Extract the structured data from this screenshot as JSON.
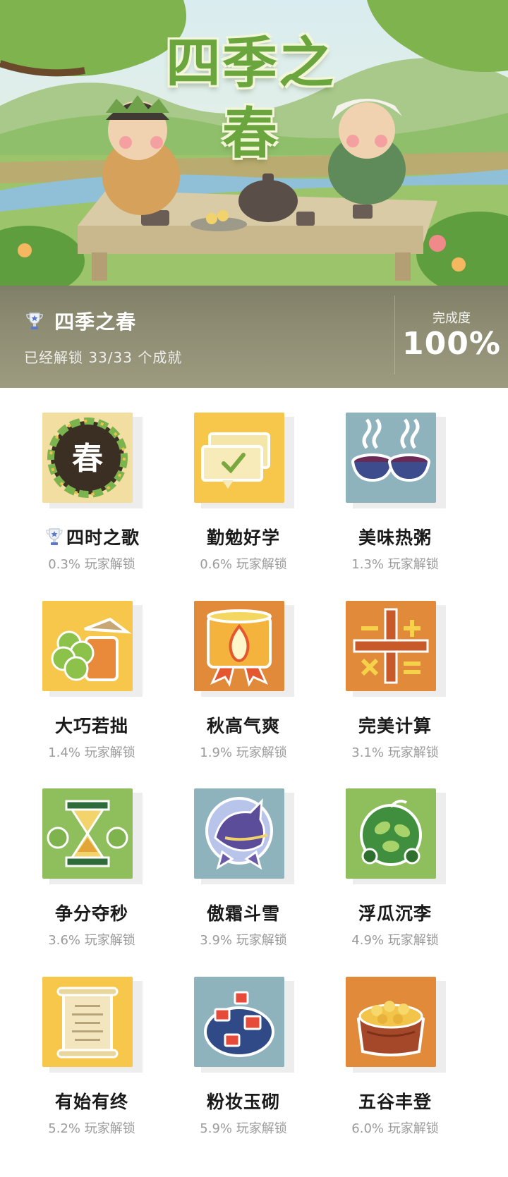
{
  "header": {
    "art_title": "四季之春",
    "game_title": "四季之春",
    "unlock_text": "已经解锁 33/33 个成就",
    "completion_label": "完成度",
    "completion_value": "100%"
  },
  "colors": {
    "panel": "#8e8d73",
    "yellow": "#f6d14a",
    "orange": "#e08a3a",
    "teal": "#8fb3bd",
    "green": "#8fbf5c",
    "text": "#1a1a1a",
    "muted": "#9a9a9a"
  },
  "achievements": [
    {
      "name": "四时之歌",
      "rate": "0.3% 玩家解锁",
      "icon": "spring-wreath-icon",
      "bg": "#f3dea2",
      "trophy": true
    },
    {
      "name": "勤勉好学",
      "rate": "0.6% 玩家解锁",
      "icon": "checkmark-bubble-icon",
      "bg": "#f6c74a"
    },
    {
      "name": "美味热粥",
      "rate": "1.3% 玩家解锁",
      "icon": "hot-porridge-icon",
      "bg": "#8fb3bd"
    },
    {
      "name": "大巧若拙",
      "rate": "1.4% 玩家解锁",
      "icon": "clover-hat-icon",
      "bg": "#f6c74a"
    },
    {
      "name": "秋高气爽",
      "rate": "1.9% 玩家解锁",
      "icon": "flame-drum-icon",
      "bg": "#e08a3a"
    },
    {
      "name": "完美计算",
      "rate": "3.1% 玩家解锁",
      "icon": "math-symbols-icon",
      "bg": "#e08a3a"
    },
    {
      "name": "争分夺秒",
      "rate": "3.6% 玩家解锁",
      "icon": "hourglass-icon",
      "bg": "#8fbf5c"
    },
    {
      "name": "傲霜斗雪",
      "rate": "3.9% 玩家解锁",
      "icon": "monster-orb-icon",
      "bg": "#8fb3bd"
    },
    {
      "name": "浮瓜沉李",
      "rate": "4.9% 玩家解锁",
      "icon": "leafy-bush-icon",
      "bg": "#8fbf5c"
    },
    {
      "name": "有始有终",
      "rate": "5.2% 玩家解锁",
      "icon": "scroll-icon",
      "bg": "#f6c74a"
    },
    {
      "name": "粉妆玉砌",
      "rate": "5.9% 玩家解锁",
      "icon": "lantern-bush-icon",
      "bg": "#8fb3bd"
    },
    {
      "name": "五谷丰登",
      "rate": "6.0% 玩家解锁",
      "icon": "harvest-basket-icon",
      "bg": "#e08a3a"
    }
  ]
}
